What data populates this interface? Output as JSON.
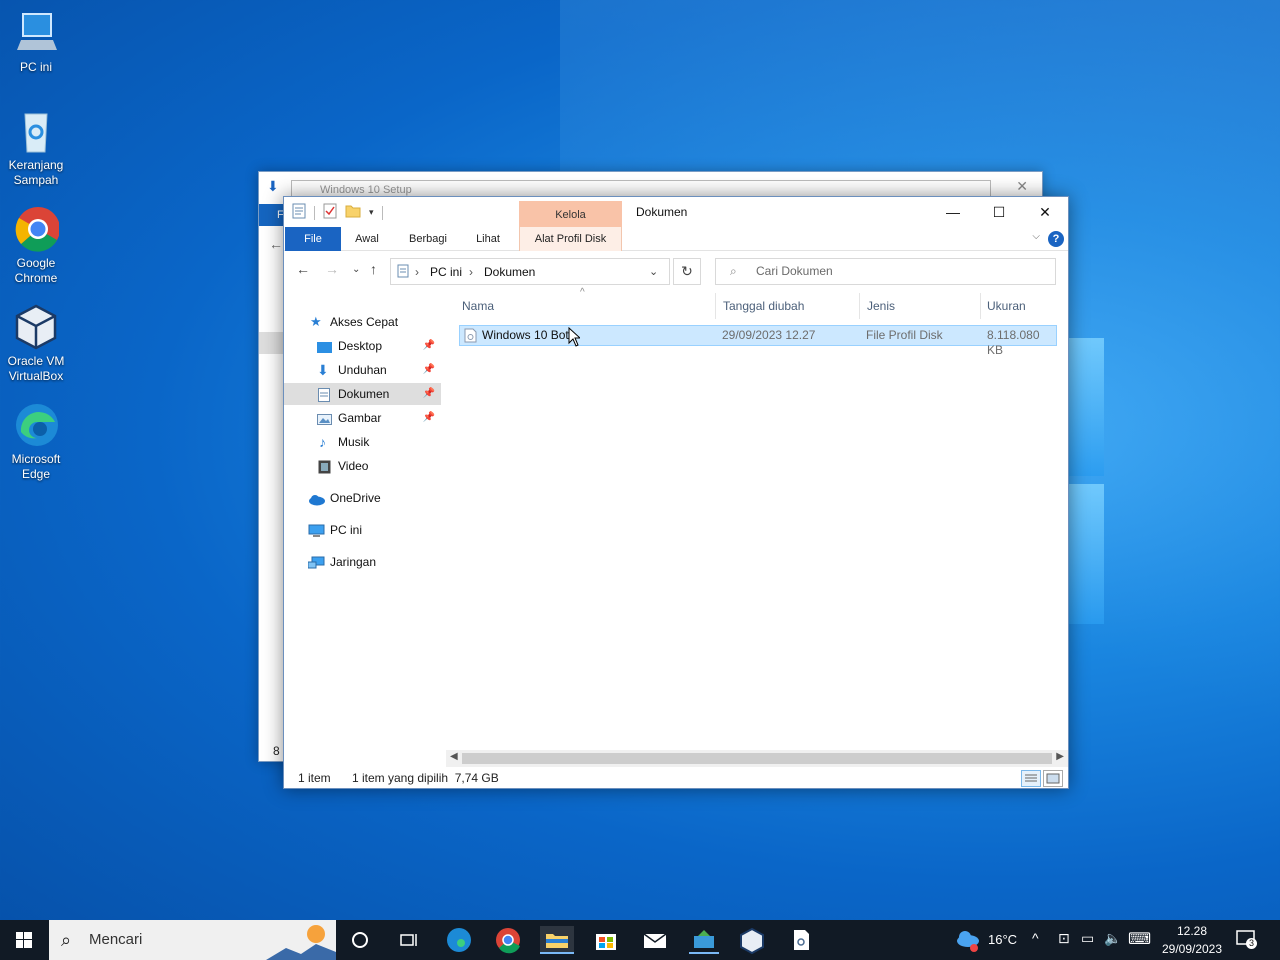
{
  "desktop": {
    "icons": [
      {
        "label": "PC ini"
      },
      {
        "label": "Keranjang Sampah"
      },
      {
        "label": "Google Chrome"
      },
      {
        "label": "Oracle VM VirtualBox"
      },
      {
        "label": "Microsoft Edge"
      }
    ]
  },
  "background_window": {
    "inner_title": "Windows 10 Setup",
    "file_tab": "F",
    "item_count": "8 i"
  },
  "explorer": {
    "context_group": "Kelola",
    "title": "Dokumen",
    "tabs": {
      "file": "File",
      "home": "Awal",
      "share": "Berbagi",
      "view": "Lihat",
      "context": "Alat Profil Disk"
    },
    "breadcrumb": [
      "PC ini",
      "Dokumen"
    ],
    "search_placeholder": "Cari Dokumen",
    "nav": {
      "quick_access": "Akses Cepat",
      "desktop": "Desktop",
      "downloads": "Unduhan",
      "documents": "Dokumen",
      "pictures": "Gambar",
      "music": "Musik",
      "video": "Video",
      "onedrive": "OneDrive",
      "pc": "PC ini",
      "network": "Jaringan"
    },
    "columns": {
      "name": "Nama",
      "date": "Tanggal diubah",
      "type": "Jenis",
      "size": "Ukuran"
    },
    "files": [
      {
        "name": "Windows 10 Bot",
        "date": "29/09/2023 12.27",
        "type": "File Profil Disk",
        "size": "8.118.080 KB"
      }
    ],
    "status": {
      "count": "1 item",
      "selected": "1 item yang dipilih  7,74 GB"
    }
  },
  "taskbar": {
    "search_placeholder": "Mencari",
    "weather": "16°C",
    "time": "12.28",
    "date": "29/09/2023",
    "notifications": "3"
  }
}
